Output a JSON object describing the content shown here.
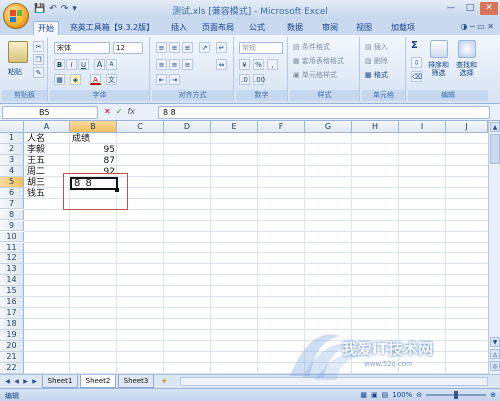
{
  "window": {
    "title": "测试.xls  [兼容模式] - Microsoft Excel",
    "controls": [
      "—",
      "□",
      "✕"
    ]
  },
  "qat": [
    "💾",
    "↶",
    "↷",
    "▾"
  ],
  "tabs": [
    "开始",
    "充英工具箱【9.3.2版】",
    "插入",
    "页面布局",
    "公式",
    "数据",
    "审阅",
    "视图",
    "加载项"
  ],
  "tab_help": "◑ ─ ▭ ✕",
  "ribbon": {
    "clipboard": {
      "paste": "粘贴",
      "label": "剪贴板"
    },
    "font": {
      "name": "宋体",
      "size": "12",
      "bold": "B",
      "italic": "I",
      "underline": "U",
      "grow": "A",
      "shrink": "A",
      "label": "字体",
      "color_a": "A"
    },
    "alignment": {
      "label": "对齐方式"
    },
    "number": {
      "format": "常规",
      "percent": "%",
      "comma": ",",
      "label": "数字"
    },
    "styles": {
      "conditional": "条件格式",
      "table": "套用表格格式",
      "cell": "单元格样式",
      "label": "样式"
    },
    "cells": {
      "insert": "插入",
      "delete": "删除",
      "format": "格式",
      "label": "单元格"
    },
    "editing": {
      "sum": "Σ",
      "sort": "排序和\n筛选",
      "find": "查找和\n选择",
      "label": "编辑"
    }
  },
  "formula_bar": {
    "name_box": "B5",
    "fx": "fx",
    "formula": "8 8"
  },
  "grid": {
    "columns": [
      "A",
      "B",
      "C",
      "D",
      "E",
      "F",
      "G",
      "H",
      "I",
      "J"
    ],
    "rows": [
      "1",
      "2",
      "3",
      "4",
      "5",
      "6",
      "7",
      "8",
      "9",
      "10",
      "11",
      "12",
      "13",
      "14",
      "15",
      "16",
      "17",
      "18",
      "19",
      "20",
      "21",
      "22"
    ],
    "cells": {
      "A1": "人名",
      "B1": "成绩",
      "A2": "李毅",
      "B2": "95",
      "A3": "王五",
      "B3": "87",
      "A4": "周二",
      "B4": "92",
      "A5": "胡三",
      "B5": "8 8",
      "A6": "钱五"
    },
    "active_cell": "B5"
  },
  "sheets": [
    "Sheet1",
    "Sheet2",
    "Sheet3"
  ],
  "active_sheet": "Sheet2",
  "status": {
    "mode": "编辑",
    "zoom": "100%"
  },
  "watermark": {
    "text": "我爱IT技术网",
    "url": "www.52ij.com"
  },
  "colors": {
    "ribbon": "#dfe8f6",
    "accent": "#15428b",
    "selected_header": "#f1c15f",
    "highlight": "#c0504d"
  }
}
